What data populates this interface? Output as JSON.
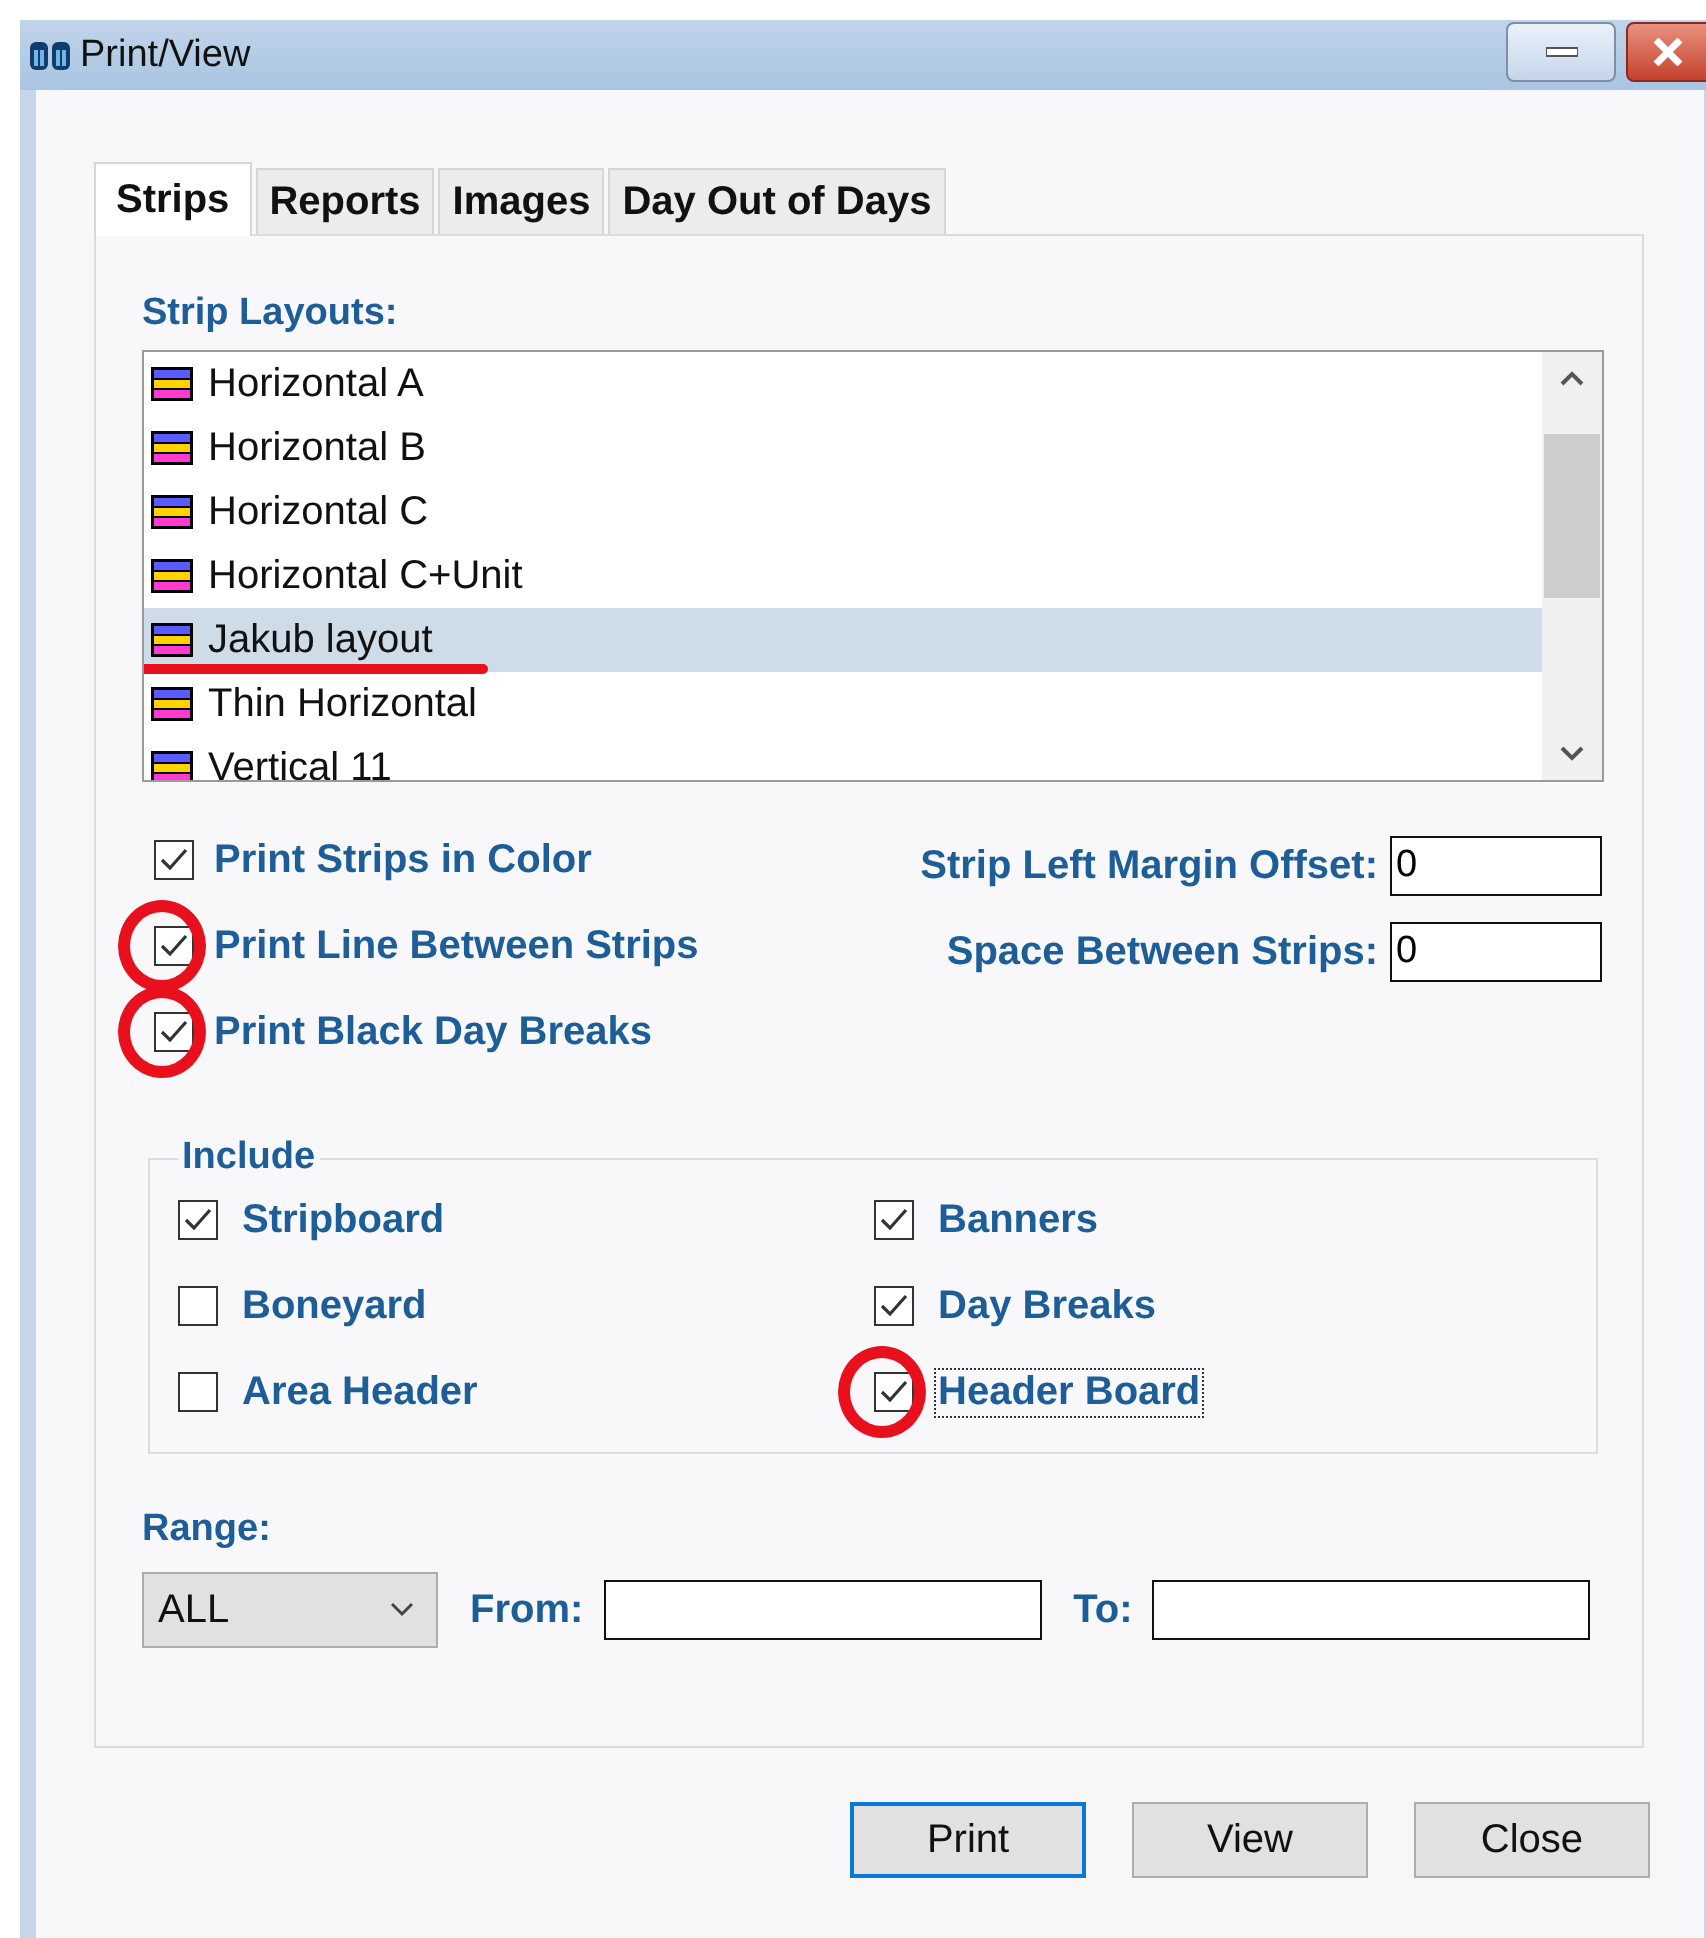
{
  "window": {
    "title": "Print/View"
  },
  "tabs": [
    {
      "label": "Strips",
      "selected": true
    },
    {
      "label": "Reports",
      "selected": false
    },
    {
      "label": "Images",
      "selected": false
    },
    {
      "label": "Day Out of Days",
      "selected": false
    }
  ],
  "strip_layouts": {
    "label": "Strip Layouts:",
    "items": [
      {
        "name": "Horizontal A",
        "selected": false,
        "underlined": false
      },
      {
        "name": "Horizontal B",
        "selected": false,
        "underlined": false
      },
      {
        "name": "Horizontal C",
        "selected": false,
        "underlined": false
      },
      {
        "name": "Horizontal C+Unit",
        "selected": false,
        "underlined": false
      },
      {
        "name": "Jakub layout",
        "selected": true,
        "underlined": true
      },
      {
        "name": "Thin Horizontal",
        "selected": false,
        "underlined": false
      },
      {
        "name": "Vertical 11",
        "selected": false,
        "underlined": false
      }
    ]
  },
  "options": [
    {
      "label": "Print Strips in Color",
      "checked": true,
      "circled": false
    },
    {
      "label": "Print Line Between Strips",
      "checked": true,
      "circled": true
    },
    {
      "label": "Print Black Day Breaks",
      "checked": true,
      "circled": true
    }
  ],
  "offset_fields": [
    {
      "label": "Strip Left Margin Offset:",
      "value": "0"
    },
    {
      "label": "Space Between Strips:",
      "value": "0"
    }
  ],
  "include": {
    "title": "Include",
    "items": [
      {
        "label": "Stripboard",
        "checked": true,
        "circled": false,
        "focused": false
      },
      {
        "label": "Banners",
        "checked": true,
        "circled": false,
        "focused": false
      },
      {
        "label": "Boneyard",
        "checked": false,
        "circled": false,
        "focused": false
      },
      {
        "label": "Day Breaks",
        "checked": true,
        "circled": false,
        "focused": false
      },
      {
        "label": "Area Header",
        "checked": false,
        "circled": false,
        "focused": false
      },
      {
        "label": "Header Board",
        "checked": true,
        "circled": true,
        "focused": true
      }
    ]
  },
  "range": {
    "label": "Range:",
    "select": "ALL",
    "from_label": "From:",
    "to_label": "To:"
  },
  "buttons": [
    {
      "label": "Print",
      "default": true
    },
    {
      "label": "View",
      "default": false
    },
    {
      "label": "Close",
      "default": false
    }
  ]
}
